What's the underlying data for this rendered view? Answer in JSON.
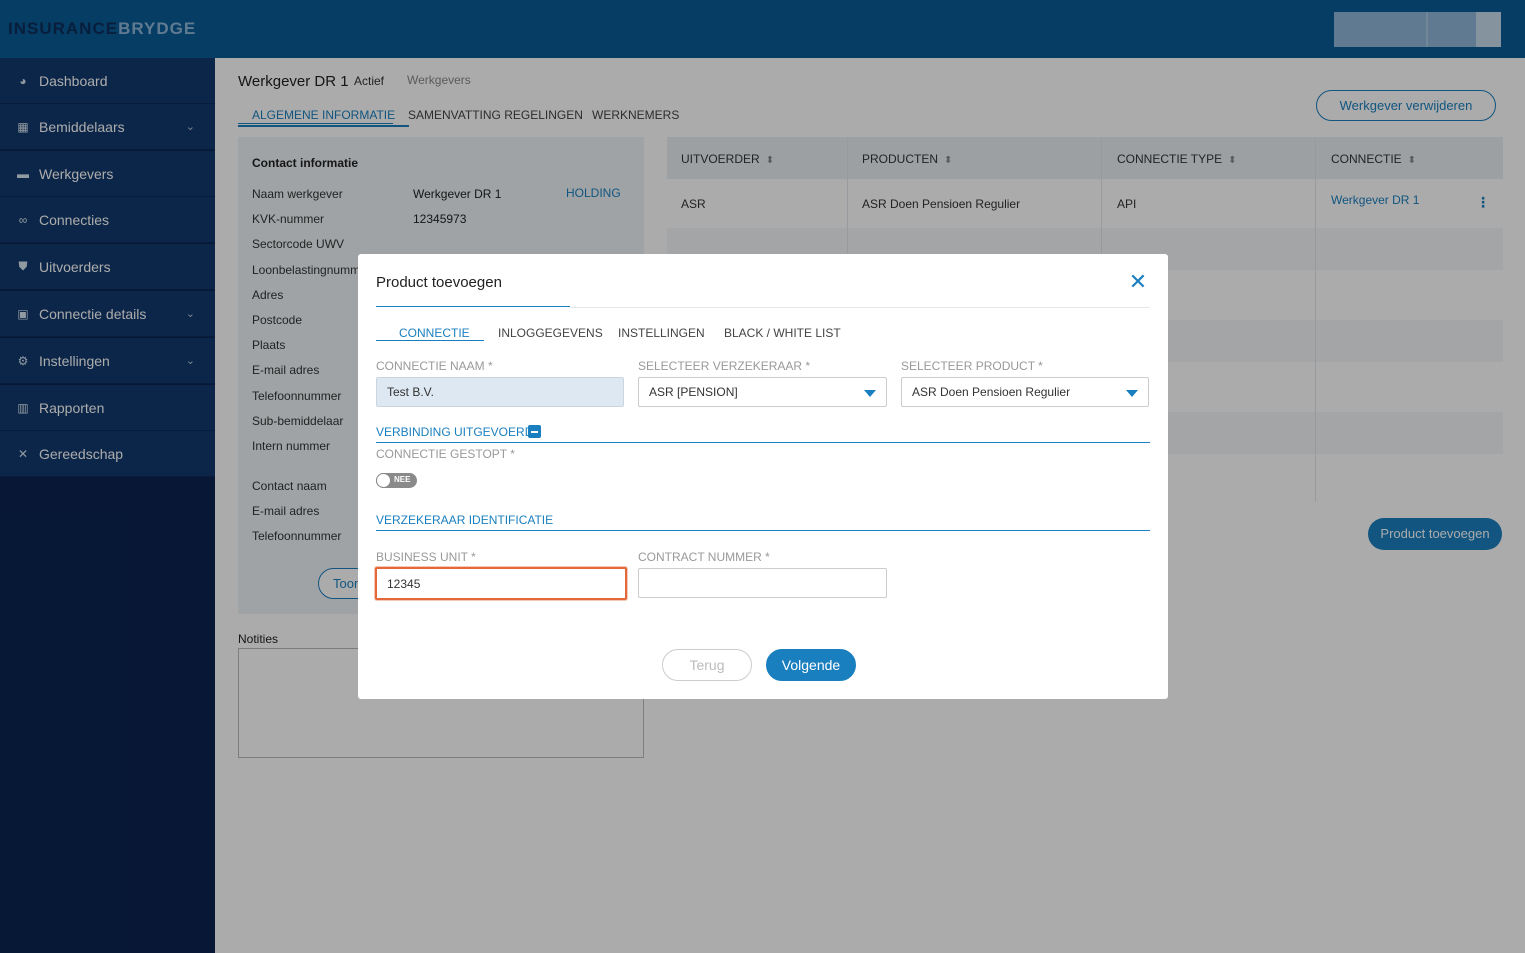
{
  "brand": {
    "part1": "INSURANCE",
    "part2": "BRYDGE"
  },
  "sidebar": {
    "items": [
      {
        "label": "Dashboard",
        "icon": "pie-chart-icon"
      },
      {
        "label": "Bemiddelaars",
        "icon": "building-icon",
        "has_submenu": true
      },
      {
        "label": "Werkgevers",
        "icon": "briefcase-icon"
      },
      {
        "label": "Connecties",
        "icon": "link-icon"
      },
      {
        "label": "Uitvoerders",
        "icon": "shield-icon"
      },
      {
        "label": "Connectie details",
        "icon": "lock-icon",
        "has_submenu": true
      },
      {
        "label": "Instellingen",
        "icon": "gear-icon",
        "has_submenu": true
      },
      {
        "label": "Rapporten",
        "icon": "bar-chart-icon"
      },
      {
        "label": "Gereedschap",
        "icon": "tools-icon"
      }
    ]
  },
  "employer": {
    "title": "Werkgever DR 1",
    "status": "Actief",
    "breadcrumb": "Werkgevers",
    "tabs": [
      "ALGEMENE INFORMATIE",
      "SAMENVATTING REGELINGEN",
      "WERKNEMERS"
    ],
    "delete_button": "Werkgever verwijderen",
    "contact": {
      "heading": "Contact informatie",
      "holding": "HOLDING",
      "labels": [
        "Naam werkgever",
        "KVK-nummer",
        "Sectorcode UWV",
        "Loonbelastingnumm",
        "Adres",
        "Postcode",
        "Plaats",
        "E-mail adres",
        "Telefoonnummer",
        "Sub-bemiddelaar",
        "Intern nummer",
        "Contact naam",
        "E-mail adres",
        "Telefoonnummer"
      ],
      "values": [
        "Werkgever DR 1",
        "12345973"
      ],
      "show_button": "Toon"
    },
    "notes_label": "Notities"
  },
  "table": {
    "headers": [
      "UITVOERDER",
      "PRODUCTEN",
      "CONNECTIE TYPE",
      "CONNECTIE"
    ],
    "rows": [
      [
        "ASR",
        "ASR Doen Pensioen Regulier",
        "API",
        "Werkgever DR 1"
      ]
    ],
    "add_button": "Product toevoegen"
  },
  "modal": {
    "title": "Product toevoegen",
    "tabs": [
      "CONNECTIE",
      "INLOGGEGEVENS",
      "INSTELLINGEN",
      "BLACK / WHITE LIST"
    ],
    "fields": {
      "connectie_naam": {
        "label": "CONNECTIE NAAM *",
        "value": "Test B.V."
      },
      "verzekeraar": {
        "label": "SELECTEER VERZEKERAAR *",
        "value": "ASR [PENSION]"
      },
      "product": {
        "label": "SELECTEER PRODUCT *",
        "value": "ASR Doen Pensioen Regulier"
      },
      "gestopt": {
        "label": "CONNECTIE GESTOPT *",
        "toggle_text": "NEE"
      },
      "business_unit": {
        "label": "BUSINESS UNIT *",
        "value": "12345"
      },
      "contract_nummer": {
        "label": "CONTRACT NUMMER *",
        "value": ""
      }
    },
    "sections": {
      "verbinding": "VERBINDING UITGEVOERD",
      "identificatie": "VERZEKERAAR IDENTIFICATIE"
    },
    "buttons": {
      "back": "Terug",
      "next": "Volgende"
    },
    "close_icon": "close-icon"
  },
  "colors": {
    "accent": "#1a7fbf",
    "topbar": "#0a5b96",
    "sidebar": "#0b2350",
    "focus": "#e5683a"
  }
}
